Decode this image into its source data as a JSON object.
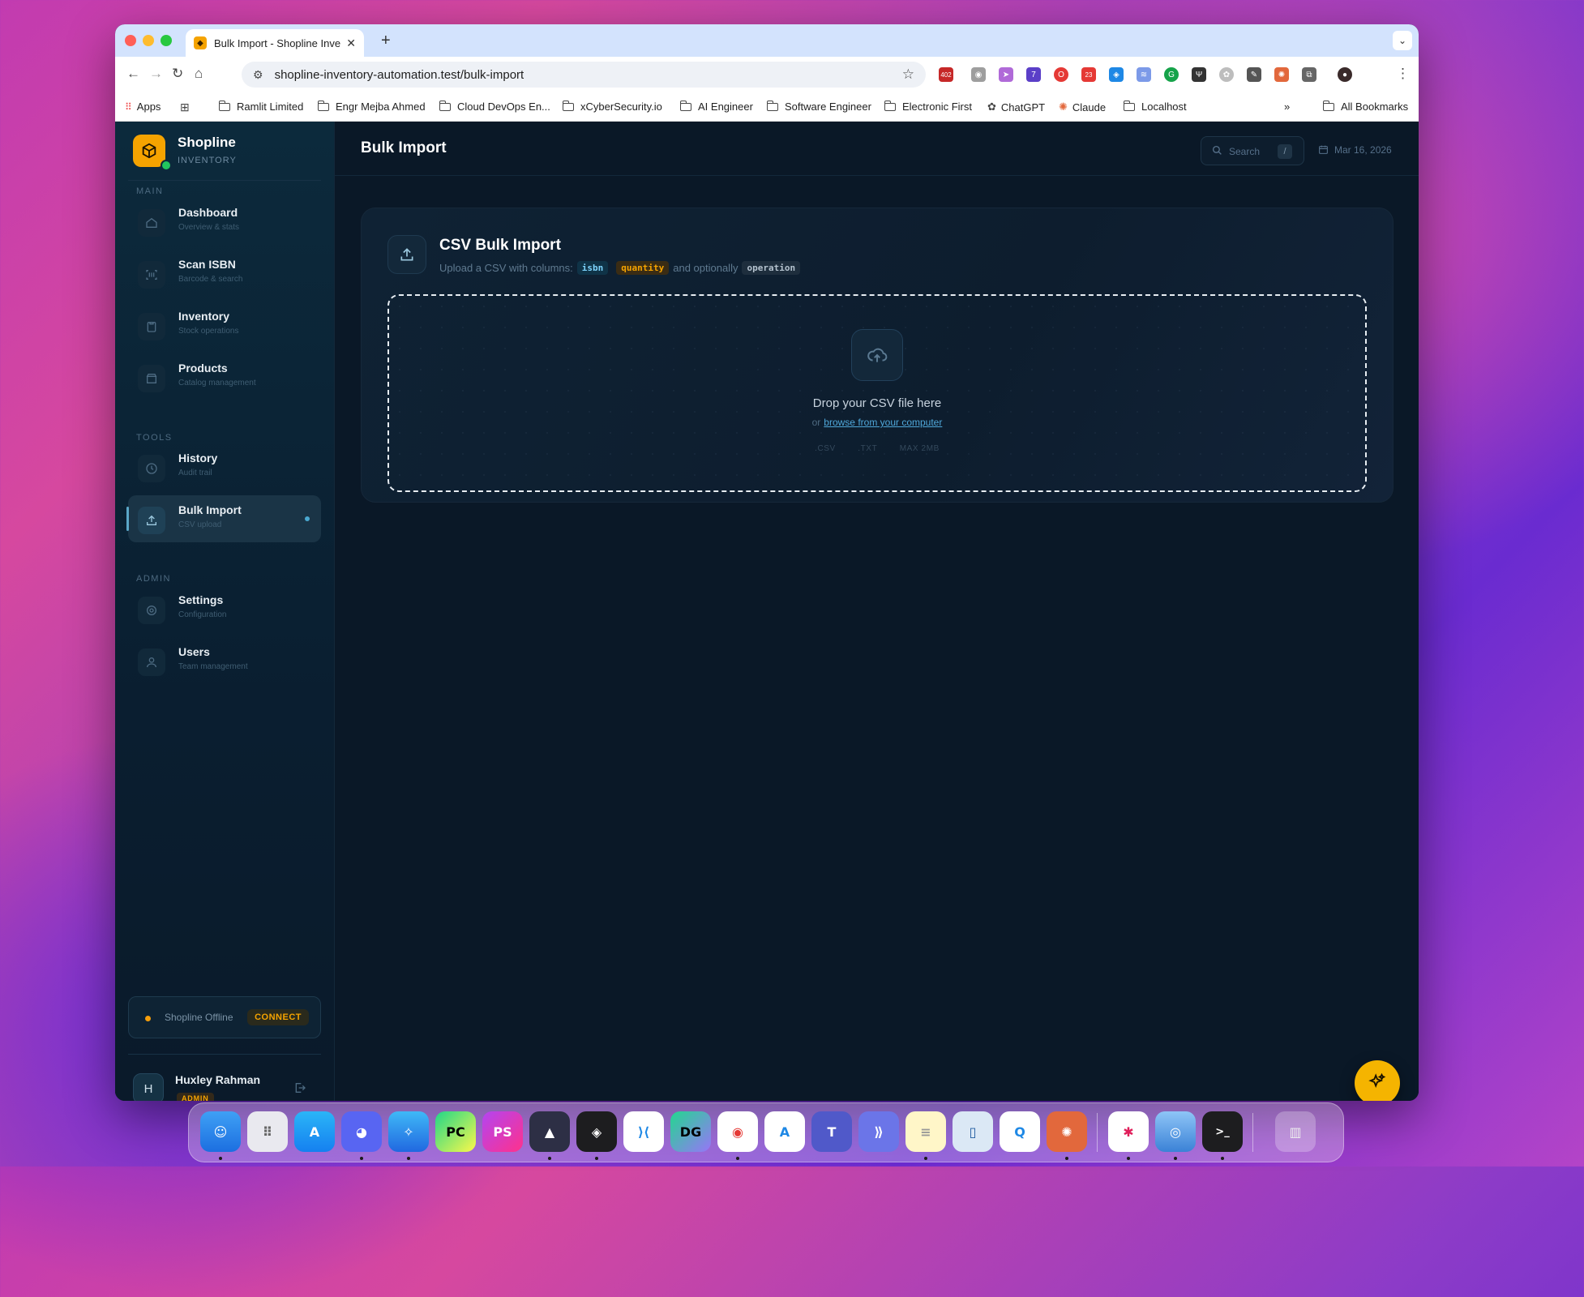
{
  "browser": {
    "tab_title": "Bulk Import - Shopline Invent",
    "url": "shopline-inventory-automation.test/bulk-import",
    "bookmarks": [
      {
        "label": "Apps",
        "type": "apps"
      },
      {
        "label": "Ramlit Limited",
        "type": "folder"
      },
      {
        "label": "Engr Mejba Ahmed",
        "type": "folder"
      },
      {
        "label": "Cloud DevOps En...",
        "type": "folder"
      },
      {
        "label": "xCyberSecurity.io",
        "type": "folder"
      },
      {
        "label": "AI Engineer",
        "type": "folder"
      },
      {
        "label": "Software Engineer",
        "type": "folder"
      },
      {
        "label": "Electronic First",
        "type": "folder"
      },
      {
        "label": "ChatGPT",
        "type": "link"
      },
      {
        "label": "Claude",
        "type": "link"
      },
      {
        "label": "Localhost",
        "type": "folder"
      }
    ],
    "all_bookmarks": "All Bookmarks",
    "ext_badges": [
      "402",
      "7",
      "23"
    ]
  },
  "sidebar": {
    "brand_name": "Shopline",
    "brand_sub": "INVENTORY",
    "sections": {
      "main": "MAIN",
      "tools": "TOOLS",
      "admin": "ADMIN"
    },
    "items": [
      {
        "title": "Dashboard",
        "sub": "Overview & stats"
      },
      {
        "title": "Scan ISBN",
        "sub": "Barcode & search"
      },
      {
        "title": "Inventory",
        "sub": "Stock operations"
      },
      {
        "title": "Products",
        "sub": "Catalog management"
      },
      {
        "title": "History",
        "sub": "Audit trail"
      },
      {
        "title": "Bulk Import",
        "sub": "CSV upload"
      },
      {
        "title": "Settings",
        "sub": "Configuration"
      },
      {
        "title": "Users",
        "sub": "Team management"
      }
    ],
    "status_text": "Shopline Offline",
    "connect_label": "CONNECT",
    "user": {
      "initial": "H",
      "name": "Huxley Rahman",
      "role": "ADMIN"
    }
  },
  "header": {
    "title": "Bulk Import",
    "search_placeholder": "Search",
    "search_shortcut": "/",
    "date": "Mar 16, 2026"
  },
  "card": {
    "title": "CSV Bulk Import",
    "sub_prefix": "Upload a CSV with columns:",
    "col_isbn": "isbn",
    "col_quantity": "quantity",
    "sub_mid": "and optionally",
    "col_operation": "operation",
    "drop_title": "Drop your CSV file here",
    "drop_or": "or",
    "drop_browse": "browse from your computer",
    "formats": [
      ".CSV",
      ".TXT",
      "MAX 2MB"
    ]
  },
  "colors": {
    "accent": "#f5a300",
    "link": "#4fa7d9",
    "bg": "#0a1827"
  }
}
